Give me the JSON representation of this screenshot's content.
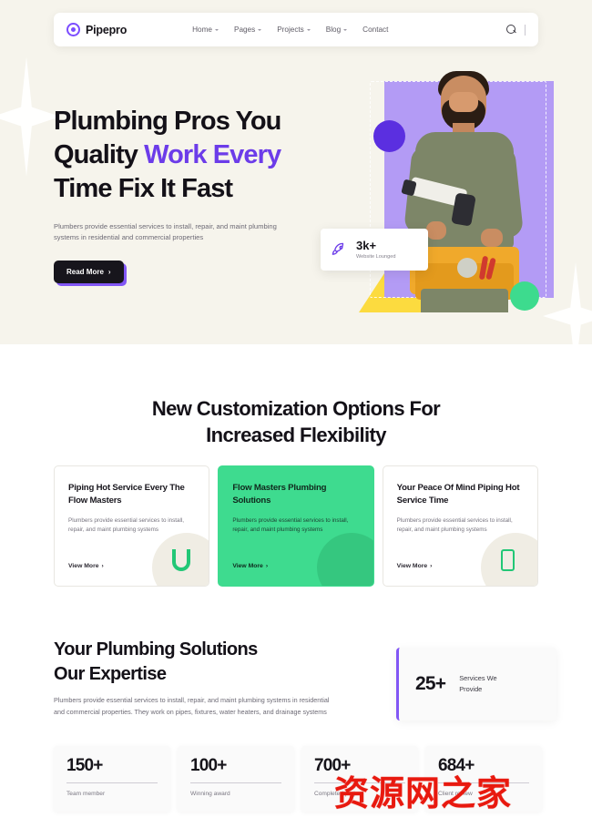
{
  "brand": {
    "name": "Pipepro",
    "logo_icon": "concentric-circle-logo-icon",
    "accent": "#7c4dff"
  },
  "nav": {
    "links": [
      {
        "label": "Home",
        "has_dropdown": true
      },
      {
        "label": "Pages",
        "has_dropdown": true
      },
      {
        "label": "Projects",
        "has_dropdown": true
      },
      {
        "label": "Blog",
        "has_dropdown": true
      },
      {
        "label": "Contact",
        "has_dropdown": false
      }
    ],
    "search_icon": "search-icon"
  },
  "hero": {
    "title_line1": "Plumbing Pros You",
    "title_line2_plain": "Quality ",
    "title_line2_highlight": "Work Every",
    "title_line3": "Time Fix It Fast",
    "highlight_color": "#6c3ce9",
    "subtitle": "Plumbers provide essential services to install, repair, and maint plumbing systems in residential and commercial properties",
    "cta_label": "Read More",
    "cta_arrow": "›",
    "badge": {
      "icon": "rocket-icon",
      "value": "3k+",
      "label": "Website Lounged"
    },
    "art": {
      "photo_alt": "plumber-holding-caulking-gun",
      "yellow": "#fcdb3f",
      "purple": "#b39bf5",
      "circle_purple": "#5b2fe0",
      "circle_green": "#3ddb8e"
    },
    "background": "#f6f4ec"
  },
  "section_customization": {
    "heading_line1": "New Customization Options For",
    "heading_line2": "Increased Flexibility",
    "cards": [
      {
        "title": "Piping Hot Service Every The Flow Masters",
        "text": "Plumbers provide essential services to install, repair, and maint plumbing systems",
        "link_label": "View More",
        "link_arrow": "›",
        "icon": "u-pipe-icon",
        "highlighted": false
      },
      {
        "title": "Flow Masters Plumbing Solutions",
        "text": "Plumbers provide essential services to install, repair, and maint plumbing systems",
        "link_label": "View More",
        "link_arrow": "›",
        "icon": "none",
        "highlighted": true,
        "bg": "#3edb8f"
      },
      {
        "title": "Your Peace Of Mind Piping Hot Service Time",
        "text": "Plumbers provide essential services to install, repair, and maint plumbing systems",
        "link_label": "View More",
        "link_arrow": "›",
        "icon": "pipe-segment-icon",
        "highlighted": false
      }
    ]
  },
  "section_expertise": {
    "heading_line1": "Your Plumbing Solutions",
    "heading_line2": "Our Expertise",
    "text": "Plumbers provide essential services to install, repair, and maint plumbing systems in residential and commercial properties. They work on pipes, fixtures, water heaters, and drainage systems",
    "services_card": {
      "value": "25+",
      "label_line1": "Services We",
      "label_line2": "Provide",
      "accent": "#8257f5"
    },
    "stats": [
      {
        "value": "150+",
        "label": "Team member"
      },
      {
        "value": "100+",
        "label": "Winning award"
      },
      {
        "value": "700+",
        "label": "Completed project"
      },
      {
        "value": "684+",
        "label": "Client review"
      }
    ]
  },
  "watermark": {
    "text": "资源网之家",
    "color": "#e8190f"
  }
}
